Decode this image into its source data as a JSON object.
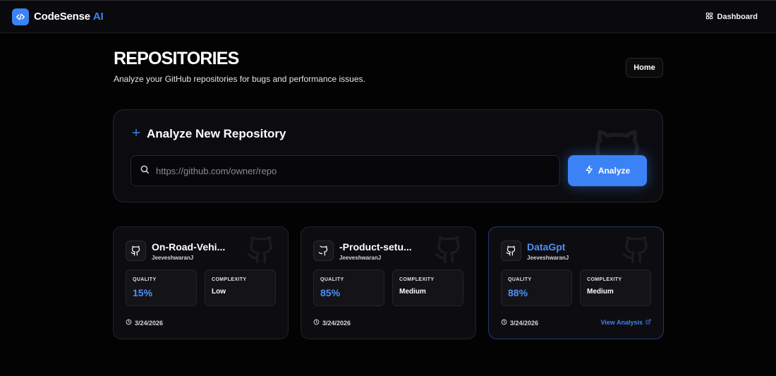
{
  "app": {
    "brand_name": "CodeSense",
    "brand_suffix": "AI",
    "nav_dashboard": "Dashboard"
  },
  "header": {
    "title": "REPOSITORIES",
    "subtitle": "Analyze your GitHub repositories for bugs and performance issues.",
    "home_button": "Home"
  },
  "analyze": {
    "title": "Analyze New Repository",
    "input_placeholder": "https://github.com/owner/repo",
    "input_value": "",
    "button_label": "Analyze"
  },
  "repos": [
    {
      "name": "On-Road-Vehi...",
      "owner": "JeeveshwaranJ",
      "quality_label": "QUALITY",
      "quality": "15%",
      "complexity_label": "COMPLEXITY",
      "complexity": "Low",
      "date": "3/24/2026"
    },
    {
      "name": "-Product-setu...",
      "owner": "JeeveshwaranJ",
      "quality_label": "QUALITY",
      "quality": "85%",
      "complexity_label": "COMPLEXITY",
      "complexity": "Medium",
      "date": "3/24/2026"
    },
    {
      "name": "DataGpt",
      "owner": "JeeveshwaranJ",
      "quality_label": "QUALITY",
      "quality": "88%",
      "complexity_label": "COMPLEXITY",
      "complexity": "Medium",
      "date": "3/24/2026",
      "view_link": "View Analysis"
    }
  ],
  "colors": {
    "accent": "#3b82f6",
    "background": "#030304",
    "card": "#0d0d11"
  },
  "icons": {
    "logo": "code-brackets-icon",
    "dashboard": "grid-icon",
    "plus": "plus-icon",
    "search": "search-icon",
    "analyze": "lightning-icon",
    "repo": "github-icon",
    "date": "clock-icon",
    "external": "external-link-icon"
  }
}
